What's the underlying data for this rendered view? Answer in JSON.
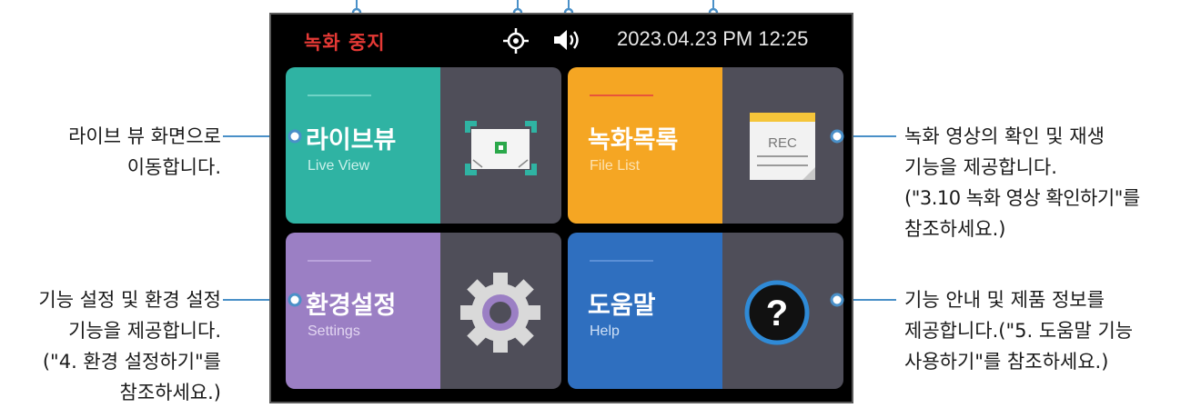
{
  "status_bar": {
    "recording_status": "녹화 중지",
    "datetime": "2023.04.23 PM 12:25",
    "gps_icon": "gps-target-icon",
    "volume_icon": "speaker-icon"
  },
  "tiles": [
    {
      "title": "라이브뷰",
      "subtitle": "Live View",
      "color": "#2fb3a3",
      "icon": "live-view-icon"
    },
    {
      "title": "녹화목록",
      "subtitle": "File List",
      "color": "#f5a623",
      "icon": "rec-file-icon",
      "icon_text": "REC"
    },
    {
      "title": "환경설정",
      "subtitle": "Settings",
      "color": "#9b7fc4",
      "icon": "gear-icon"
    },
    {
      "title": "도움말",
      "subtitle": "Help",
      "color": "#2f6fbf",
      "icon": "help-question-icon",
      "icon_text": "?"
    }
  ],
  "callouts": {
    "live_view": [
      "라이브 뷰 화면으로",
      "이동합니다."
    ],
    "file_list": [
      "녹화 영상의 확인 및 재생",
      "기능을 제공합니다.",
      "(\"3.10 녹화 영상 확인하기\"를",
      "참조하세요.)"
    ],
    "settings": [
      "기능 설정 및 환경 설정",
      "기능을 제공합니다.",
      "(\"4. 환경 설정하기\"를",
      "참조하세요.)"
    ],
    "help": [
      "기능 안내 및 제품 정보를",
      "제공합니다.(\"5. 도움말 기능",
      "사용하기\"를 참조하세요.)"
    ]
  },
  "colors": {
    "leader": "#4a90c8",
    "screen_bg": "#000000",
    "tile_gray": "#4f4e59"
  }
}
